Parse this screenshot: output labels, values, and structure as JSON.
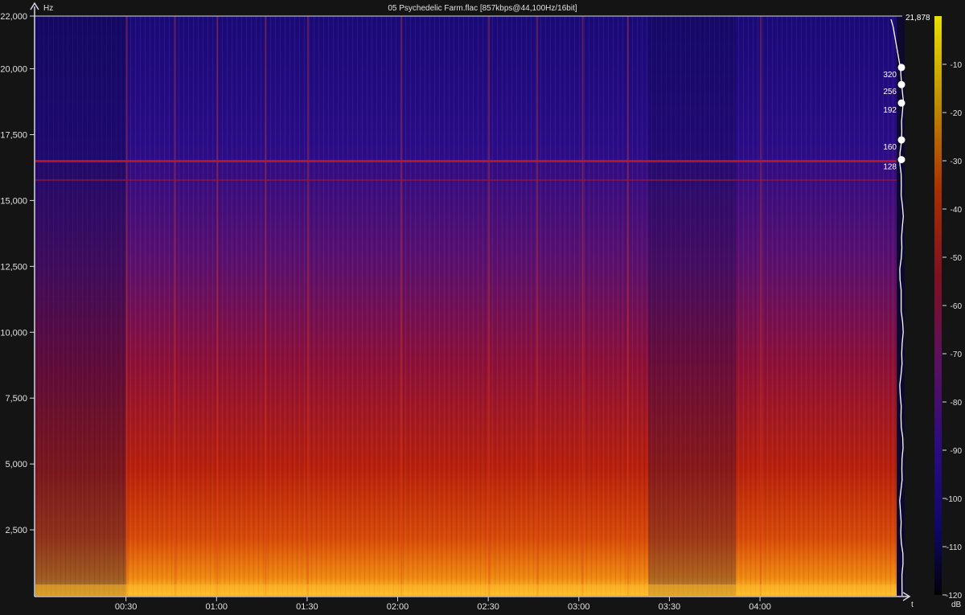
{
  "title": "05 Psychedelic Farm.flac [857kbps@44,100Hz/16bit]",
  "y_unit": "Hz",
  "x_unit": "t",
  "db_unit": "dB",
  "colors": {
    "background": "#141414",
    "axis": "#d8d8e8",
    "text": "#e0e0e0",
    "cutoff_line": "#ffffff"
  },
  "chart_data": {
    "type": "heatmap",
    "title": "05 Psychedelic Farm.flac [857kbps@44,100Hz/16bit]",
    "xlabel": "t",
    "ylabel": "Hz",
    "y_range": [
      0,
      22000
    ],
    "x_range_seconds": [
      0,
      285
    ],
    "y_ticks": [
      {
        "value": 2500,
        "label": "2,500"
      },
      {
        "value": 5000,
        "label": "5,000"
      },
      {
        "value": 7500,
        "label": "7,500"
      },
      {
        "value": 10000,
        "label": "10,000"
      },
      {
        "value": 12500,
        "label": "12,500"
      },
      {
        "value": 15000,
        "label": "15,000"
      },
      {
        "value": 17500,
        "label": "17,500"
      },
      {
        "value": 20000,
        "label": "20,000"
      },
      {
        "value": 22000,
        "label": "22,000"
      }
    ],
    "x_ticks": [
      {
        "value": 30,
        "label": "00:30"
      },
      {
        "value": 60,
        "label": "01:00"
      },
      {
        "value": 90,
        "label": "01:30"
      },
      {
        "value": 120,
        "label": "02:00"
      },
      {
        "value": 150,
        "label": "02:30"
      },
      {
        "value": 180,
        "label": "03:00"
      },
      {
        "value": 210,
        "label": "03:30"
      },
      {
        "value": 240,
        "label": "04:00"
      }
    ],
    "colorbar": {
      "unit": "dB",
      "range": [
        -120,
        0
      ],
      "ticks": [
        {
          "value": -10,
          "label": "-10"
        },
        {
          "value": -20,
          "label": "-20"
        },
        {
          "value": -30,
          "label": "-30"
        },
        {
          "value": -40,
          "label": "-40"
        },
        {
          "value": -50,
          "label": "-50"
        },
        {
          "value": -60,
          "label": "-60"
        },
        {
          "value": -70,
          "label": "-70"
        },
        {
          "value": -80,
          "label": "-80"
        },
        {
          "value": -90,
          "label": "-90"
        },
        {
          "value": -100,
          "label": "-100"
        },
        {
          "value": -110,
          "label": "-110"
        },
        {
          "value": -120,
          "label": "-120"
        }
      ]
    },
    "cutoff_peak": {
      "label": "21,878",
      "value": 21878
    },
    "bitrate_markers": [
      {
        "label": "320",
        "freq": 20050
      },
      {
        "label": "256",
        "freq": 19400
      },
      {
        "label": "192",
        "freq": 18700
      },
      {
        "label": "160",
        "freq": 17300
      },
      {
        "label": "128",
        "freq": 16550
      }
    ]
  }
}
